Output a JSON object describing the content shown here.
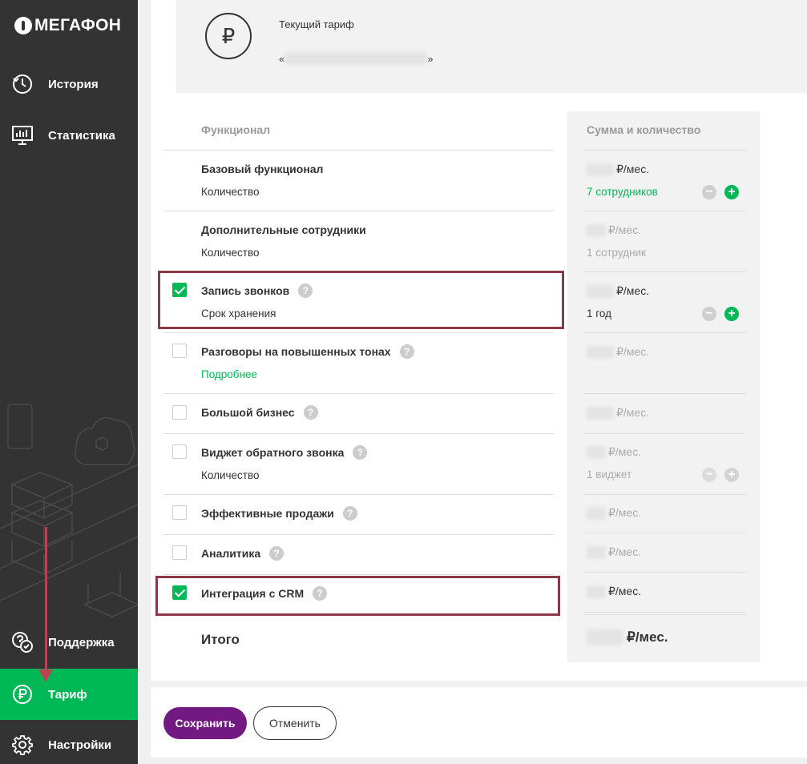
{
  "sidebar": {
    "logo": "МегаФон",
    "items": [
      {
        "label": "История",
        "icon": "clock-icon"
      },
      {
        "label": "Статистика",
        "icon": "monitor-chart-icon"
      },
      {
        "label": "Поддержка",
        "icon": "support-chat-icon"
      },
      {
        "label": "Тариф",
        "icon": "ruble-icon"
      },
      {
        "label": "Настройки",
        "icon": "gear-icon"
      }
    ],
    "active": "Тариф"
  },
  "tariff": {
    "current_label": "Текущий тариф",
    "open_quote": "«",
    "close_quote": "»",
    "symbol": "₽"
  },
  "table": {
    "col_feature": "Функционал",
    "col_sum": "Сумма и количество",
    "rows": [
      {
        "name": "Базовый функционал",
        "sub": "Количество",
        "price": "₽/мес.",
        "qty": "7 сотрудников",
        "checked": null
      },
      {
        "name": "Дополнительные сотрудники",
        "sub": "Количество",
        "price": "₽/мес.",
        "qty": "1 сотрудник",
        "checked": null
      },
      {
        "name": "Запись звонков",
        "sub": "Срок хранения",
        "price": "₽/мес.",
        "qty": "1 год",
        "checked": true
      },
      {
        "name": "Разговоры на повышенных тонах",
        "sub": "Подробнее",
        "price": "₽/мес.",
        "qty": "",
        "checked": false
      },
      {
        "name": "Большой бизнес",
        "sub": "",
        "price": "₽/мес.",
        "qty": "",
        "checked": false
      },
      {
        "name": "Виджет обратного звонка",
        "sub": "Количество",
        "price": "₽/мес.",
        "qty": "1 виджет",
        "checked": false
      },
      {
        "name": "Эффективные продажи",
        "sub": "",
        "price": "₽/мес.",
        "qty": "",
        "checked": false
      },
      {
        "name": "Аналитика",
        "sub": "",
        "price": "₽/мес.",
        "qty": "",
        "checked": false
      },
      {
        "name": "Интеграция с CRM",
        "sub": "",
        "price": "₽/мес.",
        "qty": "",
        "checked": true
      }
    ],
    "total_label": "Итого",
    "total_price": "₽/мес."
  },
  "actions": {
    "save": "Сохранить",
    "cancel": "Отменить"
  },
  "colors": {
    "sidebar_bg": "#333333",
    "accent_green": "#00b956",
    "brand_purple": "#731982",
    "highlight_box": "#8b3a45"
  }
}
